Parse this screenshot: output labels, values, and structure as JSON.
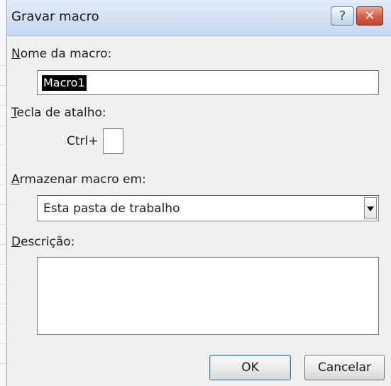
{
  "dialog": {
    "title": "Gravar macro",
    "help_glyph": "?",
    "close_glyph": "✕",
    "macro_name": {
      "label_accel": "N",
      "label_rest": "ome da macro:",
      "value": "Macro1"
    },
    "shortcut": {
      "label_accel": "T",
      "label_rest": "ecla de atalho:",
      "prefix": "Ctrl+",
      "value": ""
    },
    "store_in": {
      "label_accel": "A",
      "label_rest": "rmazenar macro em:",
      "selected": "Esta pasta de trabalho"
    },
    "description": {
      "label_accel": "D",
      "label_rest": "escrição:",
      "value": ""
    },
    "buttons": {
      "ok": "OK",
      "cancel": "Cancelar"
    }
  },
  "colors": {
    "titlebar": "#d5e2f3",
    "close_button": "#d9634a",
    "dialog_background": "#f0f0f0",
    "ok_focus_border": "#3c7fb1"
  },
  "icons": {
    "help": "help-icon",
    "close": "close-icon",
    "dropdown": "chevron-down-icon"
  }
}
